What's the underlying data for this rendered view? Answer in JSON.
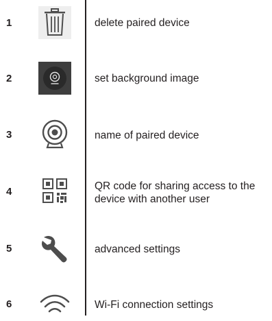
{
  "rows": [
    {
      "number": "1",
      "icon": "trash-icon",
      "label": "delete paired device"
    },
    {
      "number": "2",
      "icon": "camera-dark-tile-icon",
      "label": "set background image"
    },
    {
      "number": "3",
      "icon": "camera-icon",
      "label": "name of paired device"
    },
    {
      "number": "4",
      "icon": "qr-code-icon",
      "label": "QR code for sharing access to the device with another user"
    },
    {
      "number": "5",
      "icon": "wrench-icon",
      "label": "advanced settings"
    },
    {
      "number": "6",
      "icon": "wifi-icon",
      "label": "Wi-Fi connection settings"
    }
  ],
  "colors": {
    "text": "#231f20",
    "icon": "#4d4d4d",
    "tile_dark": "#3e3e3e",
    "tile_light": "#eeeeee"
  }
}
